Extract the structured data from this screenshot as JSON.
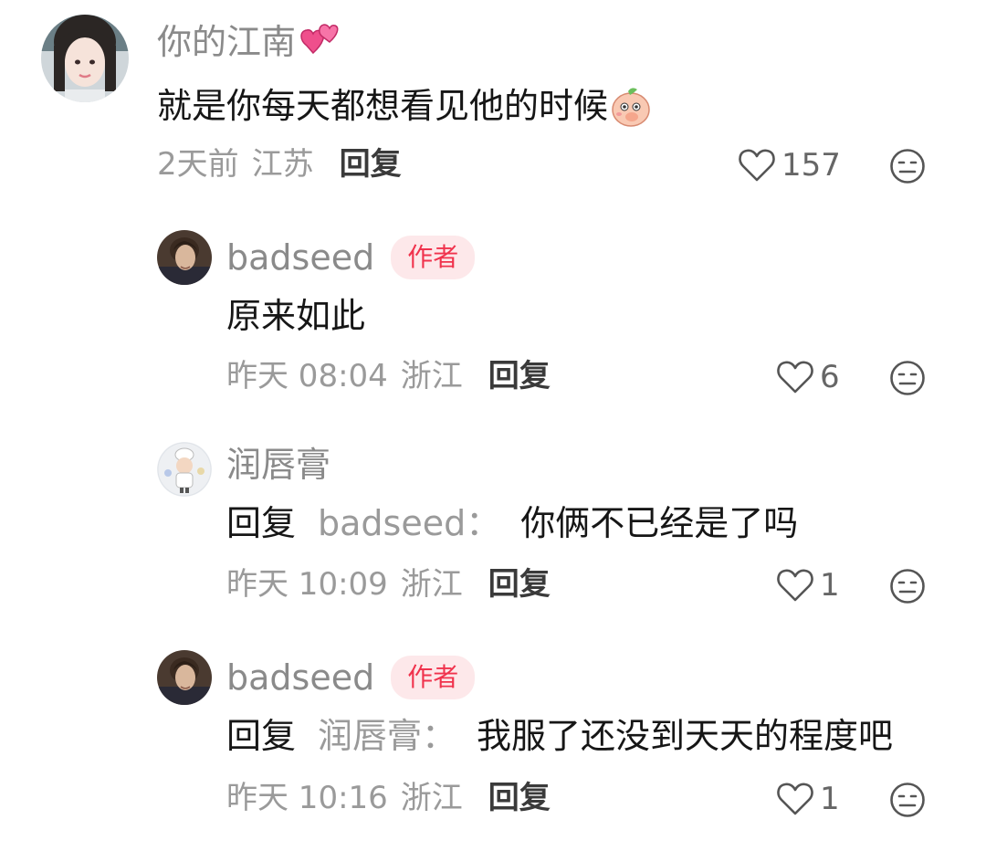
{
  "comments": [
    {
      "user": "你的江南",
      "user_emoji": "two-hearts-icon",
      "text": "就是你每天都想看见他的时候",
      "text_emoji": "peach-shy-sticker-icon",
      "time": "2天前",
      "region": "江苏",
      "reply_label": "回复",
      "likes": "157"
    }
  ],
  "replies": [
    {
      "user": "badseed",
      "badge": "作者",
      "text": "原来如此",
      "time": "昨天 08:04",
      "region": "浙江",
      "reply_label": "回复",
      "likes": "6"
    },
    {
      "user": "润唇膏",
      "reply_prefix": "回复",
      "reply_to": "badseed",
      "colon": "：",
      "text": "你俩不已经是了吗",
      "time": "昨天 10:09",
      "region": "浙江",
      "reply_label": "回复",
      "likes": "1"
    },
    {
      "user": "badseed",
      "badge": "作者",
      "reply_prefix": "回复",
      "reply_to": "润唇膏",
      "colon": "：",
      "text": "我服了还没到天天的程度吧",
      "time": "昨天 10:16",
      "region": "浙江",
      "reply_label": "回复",
      "likes": "1"
    }
  ],
  "icons": {
    "like": "heart-outline-icon",
    "dislike": "meh-face-icon"
  },
  "colors": {
    "badge_bg": "#fde8ea",
    "badge_text": "#f0334d",
    "meta": "#9a9a9a"
  }
}
